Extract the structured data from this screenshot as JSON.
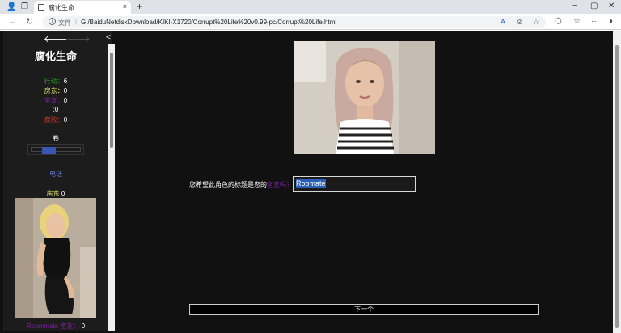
{
  "browser": {
    "tab_title": "腐化生命",
    "tab_close": "×",
    "new_tab": "+",
    "url_protocol": "文件",
    "url_sep": "|",
    "url_path": "G:/BaiduNetdiskDownload/KIKI-X1720/Corrupt%20Life%20v0.99-pc/Corrupt%20Life.html",
    "minimize": "−",
    "maximize": "▢",
    "close": "✕",
    "back": "←",
    "refresh": "↻",
    "read_aloud": "A",
    "more": "···"
  },
  "sidebar": {
    "back": "🡐",
    "forward": "🡒",
    "collapse": "<",
    "title": "腐化生命",
    "stats": [
      {
        "label": "行动：",
        "value": "6",
        "color": "#2e9e2e"
      },
      {
        "label": "房东：",
        "value": "0",
        "color": "#e8e86a"
      },
      {
        "label": "室友：",
        "value": "0",
        "color": "#7b1fa2"
      },
      {
        "label": ":",
        "value": "0",
        "color": "#ffffff"
      },
      {
        "label": "腐败：",
        "value": "0",
        "color": "#c0392b"
      }
    ],
    "volume_label": "卷",
    "volume_level": 0.35,
    "phone": "电话",
    "landlord_label": "房东",
    "landlord_value": "0",
    "roommate_name": "Roommate",
    "roommate_label": " 室友：",
    "roommate_value": "0"
  },
  "main": {
    "prompt_pre": "您希望此角色的标题是您的",
    "prompt_kw": "室友吗?",
    "name_value": "Roomate",
    "next_label": "下一个"
  }
}
